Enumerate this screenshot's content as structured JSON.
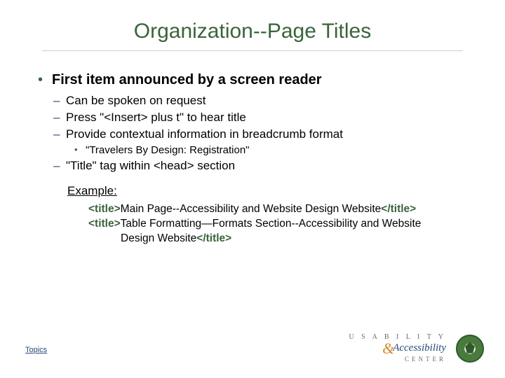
{
  "title": "Organization--Page Titles",
  "bullet1": "First item announced by a screen reader",
  "sub": {
    "a": "Can be spoken on request",
    "b": "Press \"<Insert> plus t\" to hear title",
    "c": "Provide contextual information in breadcrumb format",
    "c1": "\"Travelers By Design: Registration\"",
    "d": "\"Title\" tag within <head> section"
  },
  "example": {
    "label": "Example:",
    "tag_open": "<title>",
    "tag_close": "</title>",
    "line1_body": "Main Page--Accessibility and Website Design Website",
    "line2_body_a": "Table Formatting—Formats Section--Accessibility and Website",
    "line2_body_b": "Design Website"
  },
  "topics_link": "Topics",
  "logos": {
    "usability": "U S A B I L I T Y",
    "accessibility": "Accessibility",
    "center": "CENTER"
  }
}
